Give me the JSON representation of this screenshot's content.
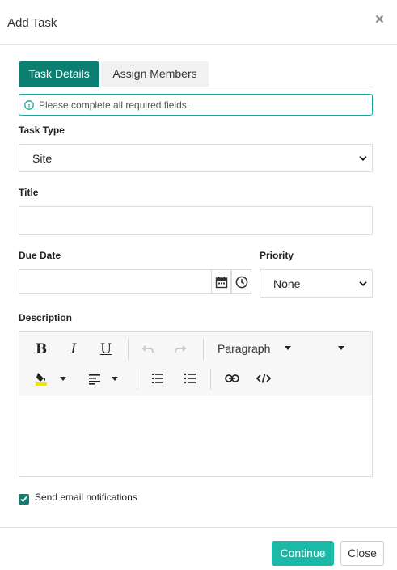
{
  "dialog": {
    "title": "Add Task",
    "close_glyph": "×"
  },
  "tabs": [
    {
      "label": "Task Details",
      "active": true
    },
    {
      "label": "Assign Members",
      "active": false
    }
  ],
  "alert": {
    "icon": "info-icon",
    "text": "Please complete all required fields."
  },
  "form": {
    "task_type": {
      "label": "Task Type",
      "value": "Site"
    },
    "title": {
      "label": "Title",
      "value": ""
    },
    "due_date": {
      "label": "Due Date",
      "value": ""
    },
    "priority": {
      "label": "Priority",
      "value": "None"
    },
    "description": {
      "label": "Description",
      "value": ""
    }
  },
  "editor_toolbar": {
    "bold": "B",
    "italic": "I",
    "underline": "U",
    "paragraph": "Paragraph"
  },
  "notifications": {
    "label": "Send email notifications",
    "checked": true
  },
  "footer": {
    "continue_label": "Continue",
    "close_label": "Close"
  },
  "colors": {
    "accent": "#0b7f71",
    "button": "#1ab9a8",
    "highlight": "#f2e600"
  }
}
